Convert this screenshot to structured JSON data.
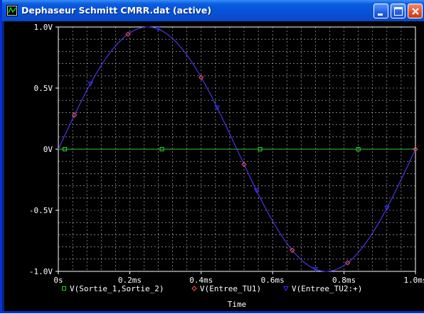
{
  "window": {
    "title": "Dephaseur Schmitt CMRR.dat (active)",
    "controls": [
      "minimize",
      "maximize",
      "close"
    ]
  },
  "colors": {
    "background": "#000000",
    "axis": "#ffffff",
    "grid": "#ffffff",
    "series1": "#33cc33",
    "series2": "#ff5555",
    "series3": "#3333ff"
  },
  "chart_data": {
    "type": "line",
    "title": "",
    "xlabel": "Time",
    "ylabel": "",
    "xlim": [
      0,
      1.0
    ],
    "ylim": [
      -1.0,
      1.0
    ],
    "grid": true,
    "x_ticks": [
      0,
      0.2,
      0.4,
      0.6,
      0.8,
      1.0
    ],
    "x_tick_labels": [
      "0s",
      "0.2ms",
      "0.4ms",
      "0.6ms",
      "0.8ms",
      "1.0ms"
    ],
    "y_ticks": [
      1.0,
      0.5,
      0,
      -0.5,
      -1.0
    ],
    "y_tick_labels": [
      "1.0V",
      "0.5V",
      "0V",
      "-0.5V",
      "-1.0V"
    ],
    "series": [
      {
        "name": "V(Sortie_1,Sortie_2)",
        "marker": "square",
        "color": "#33cc33",
        "x": [
          0,
          1.0
        ],
        "y": [
          0,
          0
        ],
        "marker_x": [
          0.018,
          0.29,
          0.565,
          0.84
        ]
      },
      {
        "name": "V(Entree_TU1)",
        "marker": "diamond",
        "color": "#ff5555",
        "function": "sin",
        "amplitude": 1.0,
        "period_ms": 1.0,
        "marker_x": [
          0.045,
          0.195,
          0.4,
          0.52,
          0.655,
          0.81,
          1.0
        ]
      },
      {
        "name": "V(Entree_TU2:+)",
        "marker": "triangle-down",
        "color": "#3333ff",
        "function": "sin",
        "amplitude": 1.0,
        "period_ms": 1.0,
        "marker_x": [
          0.09,
          0.28,
          0.445,
          0.555,
          0.72,
          0.92
        ]
      }
    ]
  }
}
